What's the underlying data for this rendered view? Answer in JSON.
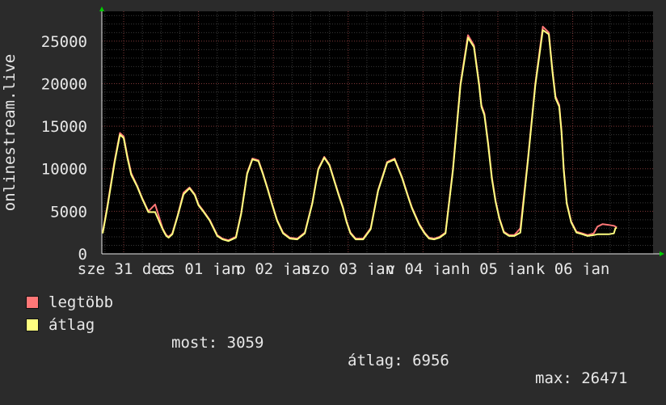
{
  "chart_data": {
    "type": "line",
    "ylabel": "onlinestream.live",
    "ylim": [
      0,
      28500
    ],
    "yticks": [
      0,
      5000,
      10000,
      15000,
      20000,
      25000
    ],
    "ytick_labels": [
      "0",
      "5000",
      "10000",
      "15000",
      "20000",
      "25000"
    ],
    "xlim": [
      0,
      6
    ],
    "xticks": [
      {
        "pos": 0,
        "label": "sze 31 dec"
      },
      {
        "pos": 1,
        "label": "cs 01 jan"
      },
      {
        "pos": 2,
        "label": "p 02 jan"
      },
      {
        "pos": 3,
        "label": "szo 03 jan"
      },
      {
        "pos": 4,
        "label": "v 04 jan"
      },
      {
        "pos": 5,
        "label": "h 05 jan"
      },
      {
        "pos": 6,
        "label": "k 06 jan"
      }
    ],
    "grid": true,
    "series": [
      {
        "name": "legtöbb",
        "color": "#ff7777",
        "x": [
          -0.32,
          -0.22,
          -0.12,
          -0.05,
          0.0,
          0.05,
          0.1,
          0.18,
          0.25,
          0.33,
          0.42,
          0.52,
          0.55,
          0.57,
          0.6,
          0.65,
          0.72,
          0.8,
          0.88,
          0.95,
          1.0,
          1.07,
          1.15,
          1.25,
          1.32,
          1.4,
          1.5,
          1.57,
          1.65,
          1.72,
          1.8,
          1.86,
          1.92,
          1.98,
          2.05,
          2.13,
          2.22,
          2.32,
          2.42,
          2.52,
          2.6,
          2.68,
          2.75,
          2.82,
          2.88,
          2.93,
          2.98,
          3.03,
          3.1,
          3.2,
          3.3,
          3.4,
          3.52,
          3.62,
          3.72,
          3.8,
          3.85,
          3.9,
          3.95,
          4.02,
          4.08,
          4.15,
          4.22,
          4.3,
          4.4,
          4.5,
          4.6,
          4.68,
          4.75,
          4.78,
          4.82,
          4.87,
          4.92,
          4.97,
          5.02,
          5.08,
          5.15,
          5.22,
          5.3,
          5.4,
          5.5,
          5.6,
          5.68,
          5.73,
          5.77,
          5.82,
          5.85,
          5.88,
          5.92,
          5.98,
          6.05,
          6.13,
          6.2,
          6.28,
          6.33,
          6.4,
          6.48,
          6.55,
          6.57,
          6.59
        ],
        "values": [
          2500,
          5500,
          11000,
          14200,
          13800,
          11500,
          9500,
          8000,
          6500,
          5000,
          5800,
          3000,
          2500,
          2200,
          2000,
          2400,
          4500,
          7200,
          7800,
          7000,
          5800,
          5000,
          4000,
          2200,
          1800,
          1600,
          2000,
          4800,
          9500,
          11200,
          11000,
          9500,
          7800,
          6000,
          4000,
          2500,
          1900,
          1800,
          2500,
          6000,
          10000,
          11400,
          10500,
          8500,
          6800,
          5500,
          3800,
          2500,
          1800,
          1800,
          3000,
          7500,
          10800,
          11200,
          9000,
          6800,
          5500,
          4500,
          3500,
          2500,
          1900,
          1800,
          2000,
          2500,
          10000,
          20000,
          25700,
          24500,
          20000,
          17500,
          16500,
          13000,
          9000,
          6200,
          4200,
          2600,
          2200,
          2200,
          3000,
          11000,
          20000,
          26700,
          26000,
          21500,
          18500,
          17500,
          14500,
          10000,
          6000,
          3800,
          2600,
          2400,
          2200,
          2400,
          3200,
          3500,
          3400,
          3300,
          3200,
          3100
        ],
        "peaks_only": true
      },
      {
        "name": "átlag",
        "color": "#ffff80",
        "x": [
          -0.32,
          -0.22,
          -0.12,
          -0.05,
          0.0,
          0.05,
          0.1,
          0.18,
          0.25,
          0.33,
          0.42,
          0.52,
          0.55,
          0.57,
          0.6,
          0.65,
          0.72,
          0.8,
          0.88,
          0.95,
          1.0,
          1.07,
          1.15,
          1.25,
          1.32,
          1.4,
          1.5,
          1.57,
          1.65,
          1.72,
          1.8,
          1.86,
          1.92,
          1.98,
          2.05,
          2.13,
          2.22,
          2.32,
          2.42,
          2.52,
          2.6,
          2.68,
          2.75,
          2.82,
          2.88,
          2.93,
          2.98,
          3.03,
          3.1,
          3.2,
          3.3,
          3.4,
          3.52,
          3.62,
          3.72,
          3.8,
          3.85,
          3.9,
          3.95,
          4.02,
          4.08,
          4.15,
          4.22,
          4.3,
          4.4,
          4.5,
          4.6,
          4.68,
          4.75,
          4.78,
          4.82,
          4.87,
          4.92,
          4.97,
          5.02,
          5.08,
          5.15,
          5.22,
          5.3,
          5.4,
          5.5,
          5.6,
          5.68,
          5.73,
          5.77,
          5.82,
          5.85,
          5.88,
          5.92,
          5.98,
          6.05,
          6.13,
          6.2,
          6.28,
          6.33,
          6.4,
          6.48,
          6.55,
          6.57,
          6.59
        ],
        "values": [
          2400,
          5300,
          10800,
          14000,
          13600,
          11300,
          9300,
          7900,
          6400,
          4900,
          4900,
          2900,
          2400,
          2100,
          1900,
          2300,
          4400,
          7000,
          7700,
          6900,
          5700,
          4900,
          3900,
          2100,
          1700,
          1500,
          1900,
          4700,
          9400,
          11100,
          10900,
          9400,
          7700,
          5900,
          3900,
          2400,
          1800,
          1700,
          2400,
          5900,
          9900,
          11300,
          10400,
          8400,
          6700,
          5400,
          3700,
          2400,
          1700,
          1700,
          2900,
          7400,
          10700,
          11100,
          8900,
          6700,
          5400,
          4400,
          3400,
          2400,
          1800,
          1700,
          1900,
          2400,
          9800,
          19800,
          25400,
          24300,
          19800,
          17300,
          16300,
          12800,
          8800,
          6100,
          4100,
          2500,
          2100,
          2100,
          2500,
          10800,
          19800,
          26300,
          25800,
          21300,
          18300,
          17300,
          14300,
          9800,
          5900,
          3700,
          2500,
          2300,
          2100,
          2200,
          2300,
          2300,
          2300,
          2400,
          3000,
          3059
        ]
      }
    ]
  },
  "legend": [
    {
      "label": "legtöbb",
      "color": "#ff7777"
    },
    {
      "label": "átlag",
      "color": "#ffff80"
    }
  ],
  "stats": {
    "most": "most: 3059",
    "atlag": "átlag: 6956",
    "max": "max: 26471"
  }
}
